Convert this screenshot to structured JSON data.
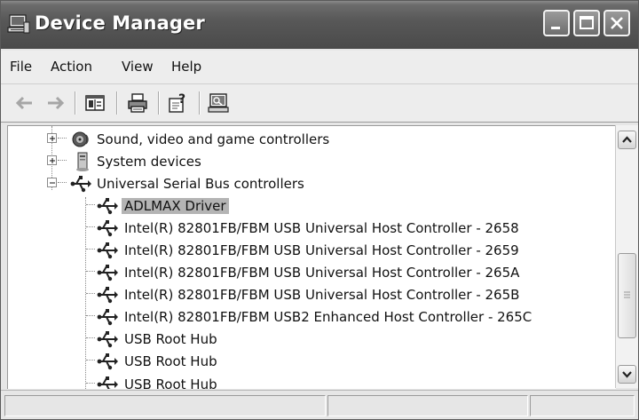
{
  "window": {
    "title": "Device Manager"
  },
  "menu": {
    "items": [
      "File",
      "Action",
      "View",
      "Help"
    ]
  },
  "tree": {
    "items": [
      {
        "label": "Sound, video and game controllers",
        "level": 1,
        "expander": "plus",
        "icon": "speaker-icon"
      },
      {
        "label": "System devices",
        "level": 1,
        "expander": "plus",
        "icon": "computer-icon"
      },
      {
        "label": "Universal Serial Bus controllers",
        "level": 1,
        "expander": "minus",
        "icon": "usb-icon"
      },
      {
        "label": "ADLMAX Driver",
        "level": 2,
        "selected": true,
        "icon": "usb-icon"
      },
      {
        "label": "Intel(R) 82801FB/FBM USB Universal Host Controller - 2658",
        "level": 2,
        "icon": "usb-icon"
      },
      {
        "label": "Intel(R) 82801FB/FBM USB Universal Host Controller - 2659",
        "level": 2,
        "icon": "usb-icon"
      },
      {
        "label": "Intel(R) 82801FB/FBM USB Universal Host Controller - 265A",
        "level": 2,
        "icon": "usb-icon"
      },
      {
        "label": "Intel(R) 82801FB/FBM USB Universal Host Controller - 265B",
        "level": 2,
        "icon": "usb-icon"
      },
      {
        "label": "Intel(R) 82801FB/FBM USB2 Enhanced Host Controller - 265C",
        "level": 2,
        "icon": "usb-icon"
      },
      {
        "label": "USB Root Hub",
        "level": 2,
        "icon": "usb-icon"
      },
      {
        "label": "USB Root Hub",
        "level": 2,
        "icon": "usb-icon"
      },
      {
        "label": "USB Root Hub",
        "level": 2,
        "icon": "usb-icon"
      }
    ]
  },
  "colors": {
    "titlebar": "#585858",
    "selection": "#b4b4b4"
  }
}
